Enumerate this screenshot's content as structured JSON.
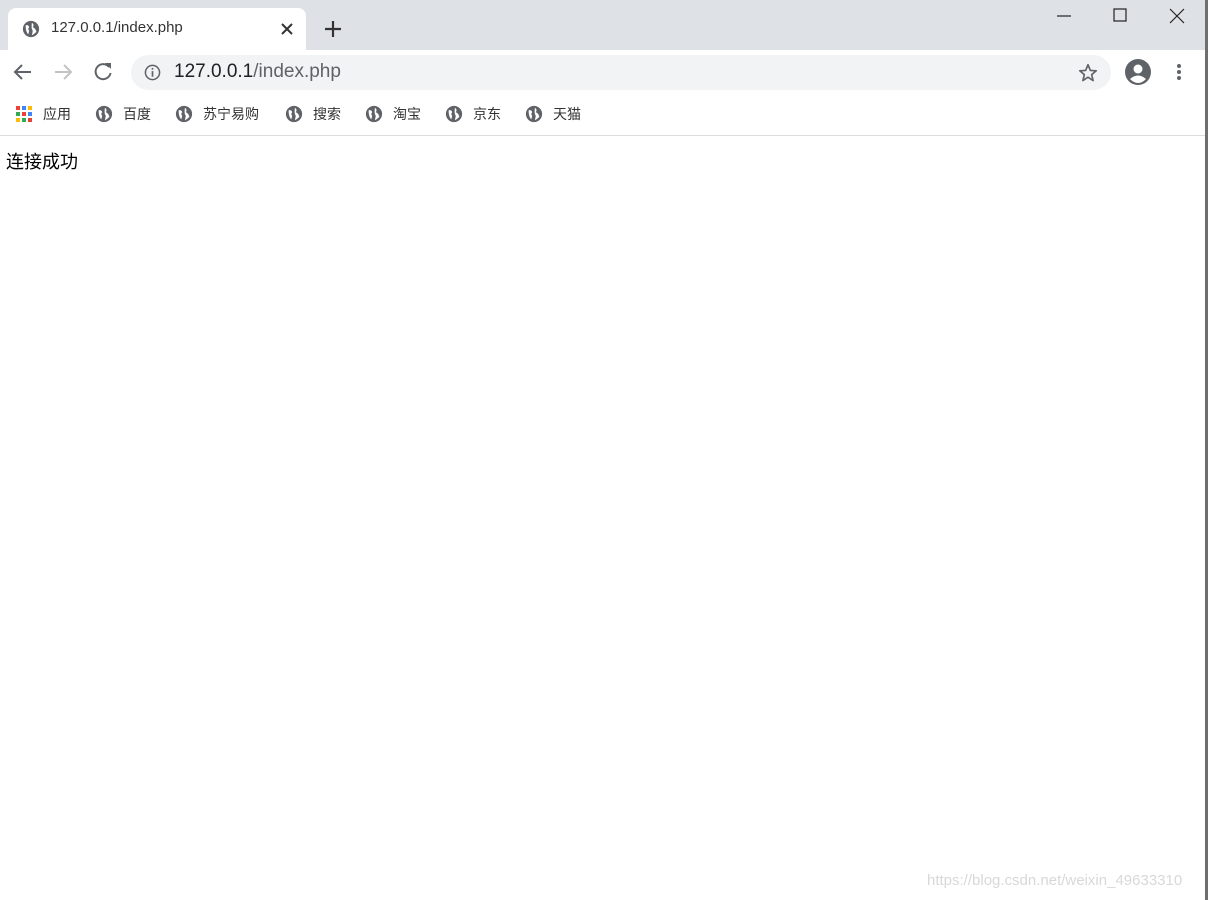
{
  "tab": {
    "title": "127.0.0.1/index.php"
  },
  "omnibox": {
    "host": "127.0.0.1",
    "path": "/index.php"
  },
  "bookmarks": [
    {
      "label": "应用",
      "icon": "apps-grid-icon"
    },
    {
      "label": "百度",
      "icon": "globe-icon"
    },
    {
      "label": "苏宁易购",
      "icon": "globe-icon"
    },
    {
      "label": "搜索",
      "icon": "globe-icon"
    },
    {
      "label": "淘宝",
      "icon": "globe-icon"
    },
    {
      "label": "京东",
      "icon": "globe-icon"
    },
    {
      "label": "天猫",
      "icon": "globe-icon"
    }
  ],
  "page": {
    "text": "连接成功"
  },
  "watermark": "https://blog.csdn.net/weixin_49633310",
  "colors": {
    "chrome_bg": "#dee1e6",
    "omnibox_bg": "#f1f3f4",
    "icon": "#5f6368"
  }
}
